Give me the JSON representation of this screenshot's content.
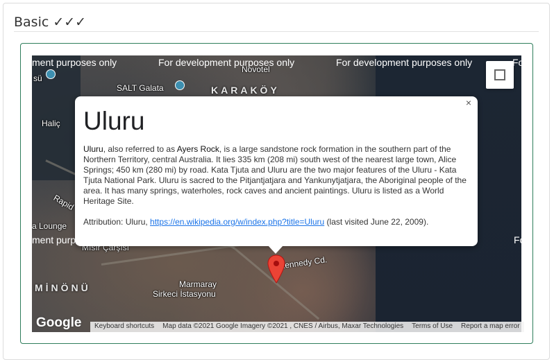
{
  "section": {
    "title": "Basic ✓✓✓"
  },
  "map": {
    "watermark_text": "For development purposes only",
    "watermark_left": "ment purposes only",
    "watermark_right": "Fo",
    "watermark_mid_left": "ment purpo",
    "watermark_mid_right": "Fo",
    "places": {
      "novotel": "Novotel",
      "salt_galata": "SALT Galata",
      "karakoy": "KARAKÖY",
      "halic": "Haliç",
      "su": "sü",
      "rapid": "Rapid",
      "lounge": "a Lounge",
      "misir": "Mısır Çarşısı",
      "eminonu": "MİNÖNÜ",
      "marmaray": "Marmaray",
      "sirkeci": "Sirkeci İstasyonu",
      "kennedy": "Kennedy Cd."
    },
    "google_logo": "Google",
    "footer": {
      "keyboard": "Keyboard shortcuts",
      "mapdata": "Map data ©2021 Google Imagery ©2021 , CNES / Airbus, Maxar Technologies",
      "terms": "Terms of Use",
      "report": "Report a map error"
    }
  },
  "info_window": {
    "close_label": "×",
    "title": "Uluru",
    "body_lead": "Uluru",
    "body_p1": ", also referred to as ",
    "body_bold": "Ayers Rock",
    "body_p2": ", is a large sandstone rock formation in the southern part of the Northern Territory, central Australia. It lies 335 km (208 mi) south west of the nearest large town, Alice Springs; 450 km (280 mi) by road. Kata Tjuta and Uluru are the two major features of the Uluru - Kata Tjuta National Park. Uluru is sacred to the Pitjantjatjara and Yankunytjatjara, the Aboriginal people of the area. It has many springs, waterholes, rock caves and ancient paintings. Uluru is listed as a World Heritage Site.",
    "attribution_prefix": "Attribution: Uluru, ",
    "attribution_link": "https://en.wikipedia.org/w/index.php?title=Uluru",
    "attribution_suffix": " (last visited June 22, 2009)."
  },
  "colors": {
    "accent": "#2e7d5b",
    "marker": "#ea4335",
    "link": "#1a73e8"
  }
}
